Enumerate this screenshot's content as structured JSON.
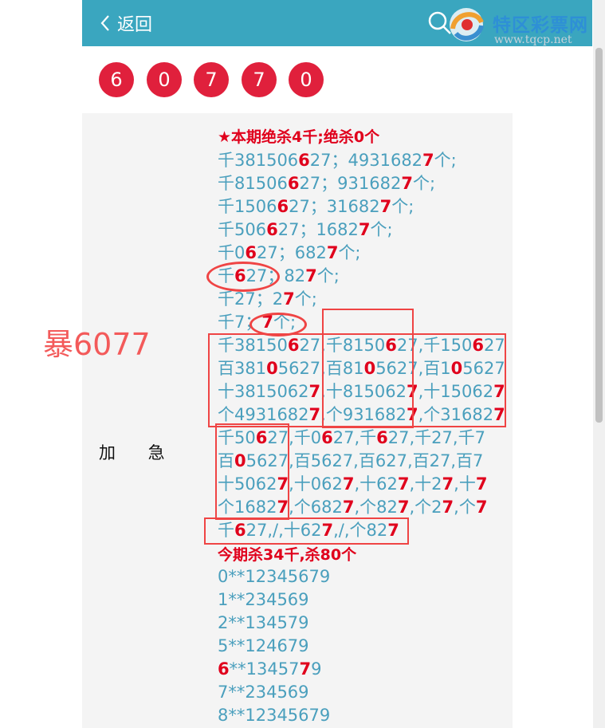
{
  "header": {
    "back_label": "返回",
    "logo_name": "特区彩票网",
    "logo_url": "www.tqcp.net",
    "bg": "#3aa6bf"
  },
  "result_balls": [
    "6",
    "0",
    "7",
    "7",
    "0"
  ],
  "side_note": "暴6077",
  "label_urgent": "加 急",
  "lines": {
    "l0": "★本期绝杀4千;绝杀0个",
    "l1": [
      "千381506",
      "6",
      "27；4931682",
      "7",
      "个;"
    ],
    "l2": [
      "千81506",
      "6",
      "27；931682",
      "7",
      "个;"
    ],
    "l3": [
      "千1506",
      "6",
      "27；31682",
      "7",
      "个;"
    ],
    "l4": [
      "千506",
      "6",
      "27；1682",
      "7",
      "个;"
    ],
    "l5": [
      "千0",
      "6",
      "27；682",
      "7",
      "个;"
    ],
    "l6": [
      "千",
      "6",
      "27；82",
      "7",
      "个;"
    ],
    "l7": [
      "千27；2",
      "7",
      "个;"
    ],
    "l8": [
      "千7；",
      "7",
      "个;"
    ],
    "l9": [
      "千38150",
      "6",
      "27,千8150",
      "6",
      "27,千150",
      "6",
      "27"
    ],
    "l10": [
      "百381",
      "0",
      "5627,百81",
      "0",
      "5627,百1",
      "0",
      "5627"
    ],
    "l11": [
      "十3815062",
      "7",
      ",十815062",
      "7",
      ",十15062",
      "7"
    ],
    "l12": [
      "个4931682",
      "7",
      ",个931682",
      "7",
      ",个31682",
      "7"
    ],
    "l13": [
      "千50",
      "6",
      "27,千0",
      "6",
      "27,千",
      "6",
      "27,千27,千7"
    ],
    "l14": [
      "百",
      "0",
      "5627,百5627,百627,百27,百7"
    ],
    "l15": [
      "十5062",
      "7",
      ",十062",
      "7",
      ",十62",
      "7",
      ",十2",
      "7",
      ",十",
      "7"
    ],
    "l16": [
      "个1682",
      "7",
      ",个682",
      "7",
      ",个82",
      "7",
      ",个2",
      "7",
      ",个",
      "7"
    ],
    "l17": [
      "千",
      "6",
      "27,/,十62",
      "7",
      ",/,个82",
      "7"
    ],
    "l18": "今期杀34千,杀80个",
    "l19": "0**12345679",
    "l20": "1**234569",
    "l21": "2**134579",
    "l22": "5**124679",
    "l23": [
      "6",
      "**13457",
      "7",
      "9"
    ],
    "l24": "7**234569",
    "l25": "8**12345679"
  }
}
